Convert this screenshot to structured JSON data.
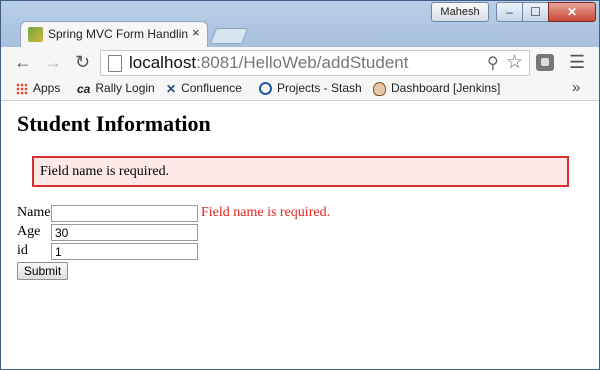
{
  "browser": {
    "profile_name": "Mahesh",
    "tab": {
      "title": "Spring MVC Form Handlin",
      "close": "×"
    },
    "nav": {
      "back": "←",
      "forward": "→",
      "reload": "↻"
    },
    "address": {
      "host": "localhost",
      "path": ":8081/HelloWeb/addStudent"
    },
    "icons": {
      "zoom": "⚲",
      "star": "☆",
      "menu": "☰",
      "more": "»"
    },
    "window_controls": {
      "minimize": "–",
      "maximize": "☐",
      "close": "✕"
    },
    "bookmarks": [
      {
        "label": "Apps",
        "icon": "apps-icon"
      },
      {
        "label": "Rally Login",
        "icon": "ca-icon",
        "icon_text": "ca"
      },
      {
        "label": "Confluence",
        "icon": "confluence-icon",
        "icon_text": "✕"
      },
      {
        "label": "Projects - Stash",
        "icon": "stash-icon"
      },
      {
        "label": "Dashboard [Jenkins]",
        "icon": "jenkins-icon"
      }
    ]
  },
  "page": {
    "heading": "Student Information",
    "error_summary": "Field name is required.",
    "form": {
      "fields": [
        {
          "label": "Name",
          "value": "",
          "error": "Field name is required."
        },
        {
          "label": "Age",
          "value": "30"
        },
        {
          "label": "id",
          "value": "1"
        }
      ],
      "submit_label": "Submit"
    }
  },
  "colors": {
    "error": "#e3221f",
    "error_border": "#d5312f",
    "error_bg": "#fce9e8"
  }
}
